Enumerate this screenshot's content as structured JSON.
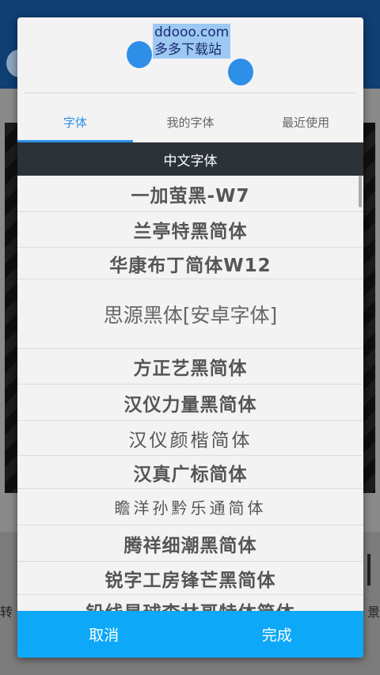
{
  "watermark": {
    "line1": "ddooo.com",
    "line2": "多多下载站"
  },
  "tabs": [
    {
      "label": "字体",
      "active": true
    },
    {
      "label": "我的字体",
      "active": false
    },
    {
      "label": "最近使用",
      "active": false
    }
  ],
  "section_title": "中文字体",
  "fonts": [
    "一加萤黑-W7",
    "兰亭特黑简体",
    "华康布丁简体W12",
    "思源黑体[安卓字体]",
    "方正艺黑简体",
    "汉仪力量黑简体",
    "汉仪颜楷简体",
    "汉真广标简体",
    "瞻洋孙黔乐通简体",
    "腾祥细潮黑简体",
    "锐字工房锋芒黑简体",
    "铅线是球李林哥特体简体"
  ],
  "footer": {
    "cancel": "取消",
    "done": "完成"
  },
  "background": {
    "left_text": "转",
    "right_text": "景"
  },
  "colors": {
    "accent": "#2e8fe8",
    "footer": "#0ea8f8",
    "section_header": "#2b3238"
  }
}
